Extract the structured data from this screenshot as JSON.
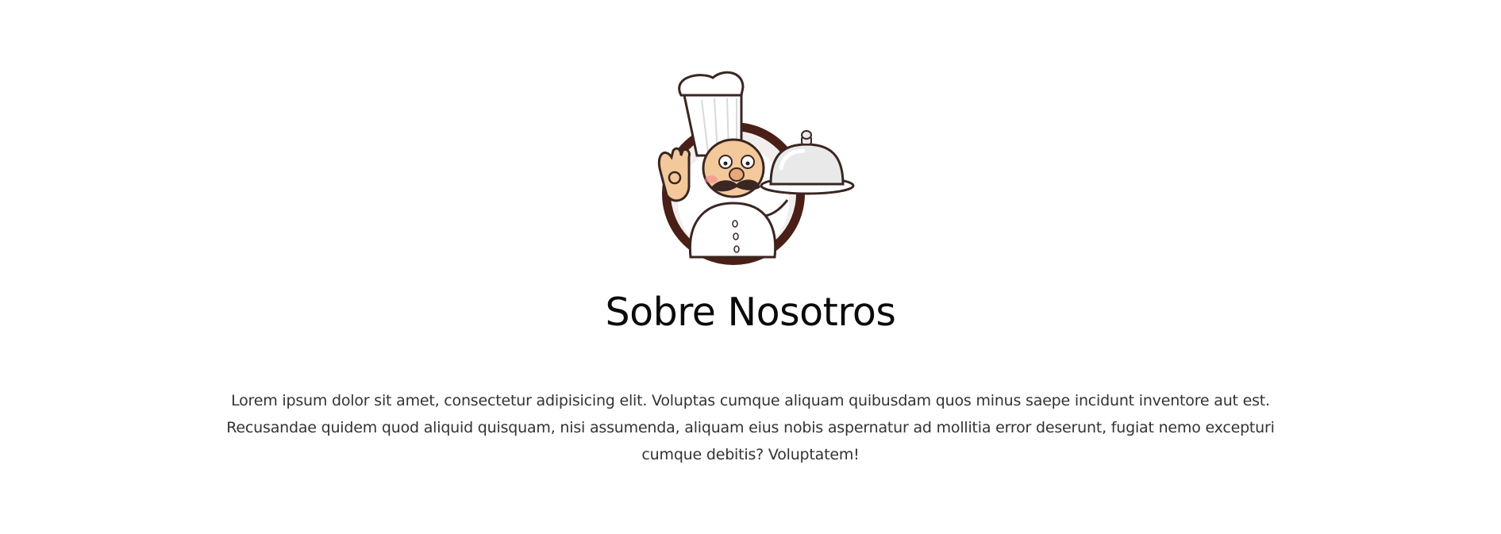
{
  "about": {
    "logo_icon": "chef-with-cloche-icon",
    "title": "Sobre Nosotros",
    "description": "Lorem ipsum dolor sit amet, consectetur adipisicing elit. Voluptas cumque aliquam quibusdam quos minus saepe incidunt inventore aut est. Recusandae quidem quod aliquid quisquam, nisi assumenda, aliquam eius nobis aspernatur ad mollitia error deserunt, fugiat nemo excepturi cumque debitis? Voluptatem!"
  },
  "colors": {
    "background": "#ffffff",
    "ring": "#4a1f17",
    "title": "#0b0b0b",
    "body_text": "#333333"
  }
}
